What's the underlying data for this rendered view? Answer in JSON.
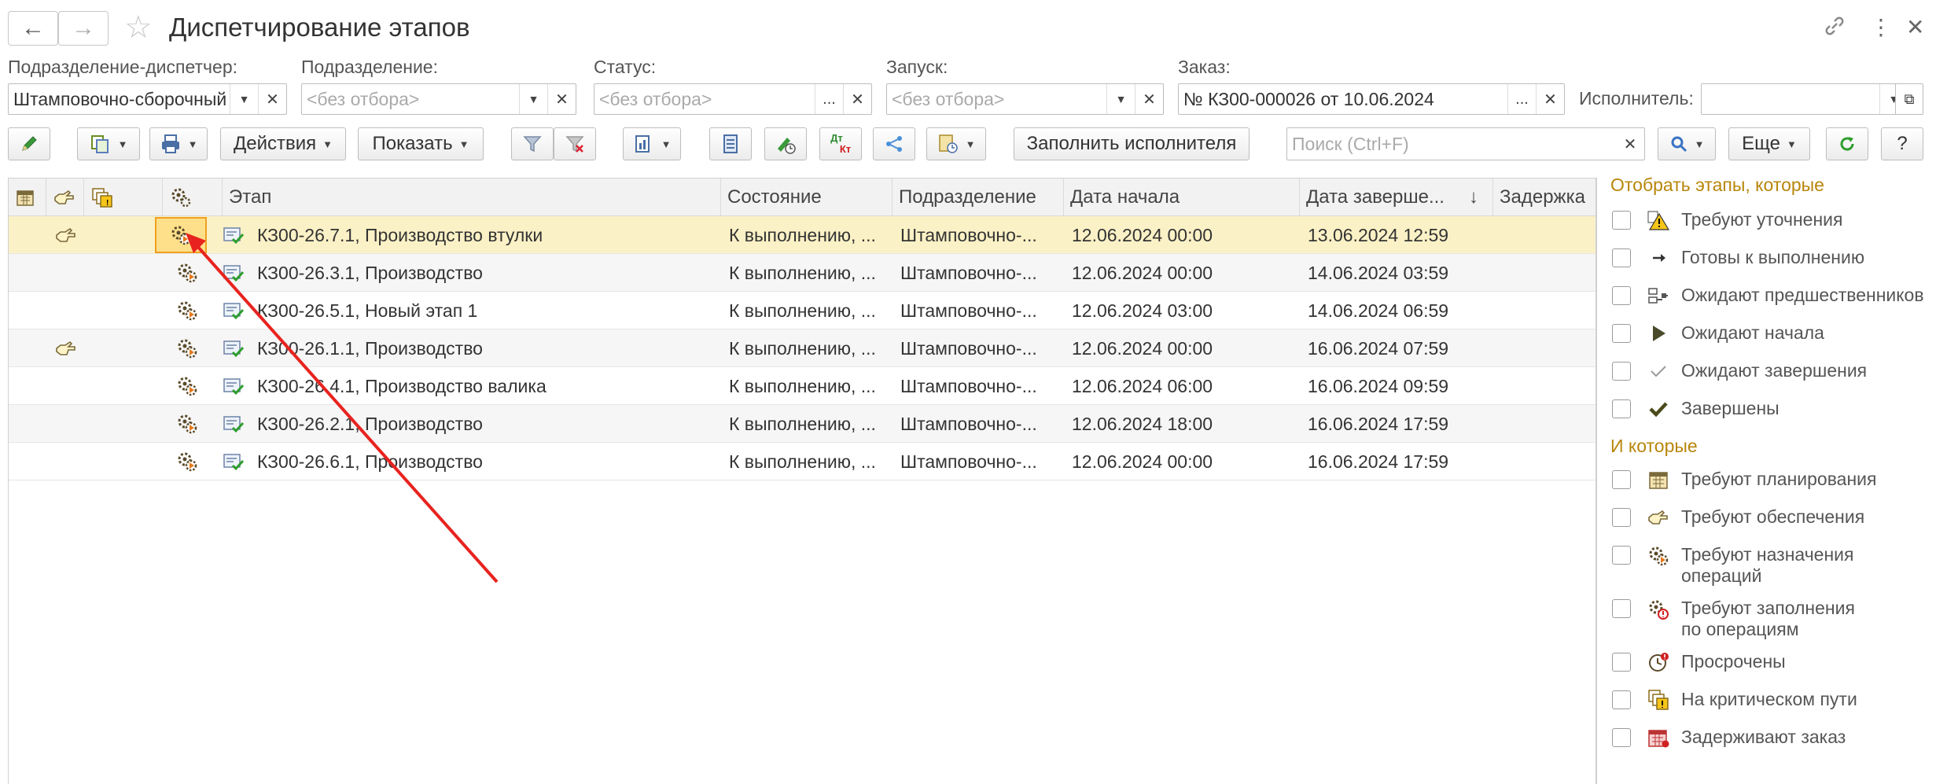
{
  "window": {
    "title": "Диспетчирование этапов",
    "back_icon": "arrow-left-icon",
    "forward_icon": "arrow-right-icon",
    "favorite_icon": "star-icon",
    "link_icon": "link-icon",
    "more_icon": "more-vertical-icon",
    "close_icon": "close-icon"
  },
  "filters": {
    "dispatcher": {
      "label": "Подразделение-диспетчер:",
      "value": "Штамповочно-сборочный"
    },
    "division": {
      "label": "Подразделение:",
      "placeholder": "<без отбора>"
    },
    "status": {
      "label": "Статус:",
      "placeholder": "<без отбора>"
    },
    "launch": {
      "label": "Запуск:",
      "placeholder": "<без отбора>"
    },
    "order": {
      "label": "Заказ:",
      "value": "№ КЗ00-000026 от 10.06.2024"
    },
    "executor": {
      "label": "Исполнитель:",
      "value": ""
    }
  },
  "toolbar": {
    "actions_label": "Действия",
    "show_label": "Показать",
    "dt_kt_top": "Дт",
    "dt_kt_bottom": "Кт",
    "fill_executor_label": "Заполнить исполнителя",
    "search_placeholder": "Поиск (Ctrl+F)",
    "more_label": "Еще",
    "help_label": "?"
  },
  "table": {
    "columns": [
      "Этап",
      "Состояние",
      "Подразделение",
      "Дата начала",
      "Дата заверше...",
      "Задержка"
    ],
    "sort_arrow": "↓",
    "rows": [
      {
        "stage": "КЗ00-26.7.1, Производство втулки",
        "state": "К выполнению, ...",
        "division": "Штамповочно-...",
        "start": "12.06.2024 00:00",
        "end": "13.06.2024 12:59",
        "delay": "",
        "hand": true,
        "selected": true
      },
      {
        "stage": "КЗ00-26.3.1, Производство",
        "state": "К выполнению, ...",
        "division": "Штамповочно-...",
        "start": "12.06.2024 00:00",
        "end": "14.06.2024 03:59",
        "delay": "",
        "hand": false,
        "selected": false
      },
      {
        "stage": "КЗ00-26.5.1, Новый этап 1",
        "state": "К выполнению, ...",
        "division": "Штамповочно-...",
        "start": "12.06.2024 03:00",
        "end": "14.06.2024 06:59",
        "delay": "",
        "hand": false,
        "selected": false
      },
      {
        "stage": "КЗ00-26.1.1, Производство",
        "state": "К выполнению, ...",
        "division": "Штамповочно-...",
        "start": "12.06.2024 00:00",
        "end": "16.06.2024 07:59",
        "delay": "",
        "hand": true,
        "selected": false
      },
      {
        "stage": "КЗ00-26.4.1, Производство валика",
        "state": "К выполнению, ...",
        "division": "Штамповочно-...",
        "start": "12.06.2024 06:00",
        "end": "16.06.2024 09:59",
        "delay": "",
        "hand": false,
        "selected": false
      },
      {
        "stage": "КЗ00-26.2.1, Производство",
        "state": "К выполнению, ...",
        "division": "Штамповочно-...",
        "start": "12.06.2024 18:00",
        "end": "16.06.2024 17:59",
        "delay": "",
        "hand": false,
        "selected": false
      },
      {
        "stage": "КЗ00-26.6.1, Производство",
        "state": "К выполнению, ...",
        "division": "Штамповочно-...",
        "start": "12.06.2024 00:00",
        "end": "16.06.2024 17:59",
        "delay": "",
        "hand": false,
        "selected": false
      }
    ]
  },
  "panel": {
    "group1_title": "Отобрать этапы, которые",
    "group1": [
      {
        "label": "Требуют уточнения",
        "icon": "warning-icon"
      },
      {
        "label": "Готовы к выполнению",
        "icon": "arrow-right-icon"
      },
      {
        "label": "Ожидают предшественников",
        "icon": "predecessor-icon"
      },
      {
        "label": "Ожидают начала",
        "icon": "play-icon"
      },
      {
        "label": "Ожидают завершения",
        "icon": "light-check-icon"
      },
      {
        "label": "Завершены",
        "icon": "check-icon"
      }
    ],
    "group2_title": "И которые",
    "group2": [
      {
        "label": "Требуют планирования",
        "icon": "calendar-icon"
      },
      {
        "label": "Требуют обеспечения",
        "icon": "hand-icon"
      },
      {
        "label": "Требуют назначения\nопераций",
        "icon": "gear-icon"
      },
      {
        "label": "Требуют заполнения\nпо операциям",
        "icon": "gear-alert-icon"
      },
      {
        "label": "Просрочены",
        "icon": "clock-alert-icon"
      },
      {
        "label": "На критическом пути",
        "icon": "critical-path-icon"
      },
      {
        "label": "Задерживают заказ",
        "icon": "delay-order-icon"
      }
    ]
  },
  "colors": {
    "selected_row": "#fbf1c6",
    "panel_title": "#b8860b",
    "annotation_arrow": "#e8231f",
    "refresh_green": "#2e9e2e"
  }
}
